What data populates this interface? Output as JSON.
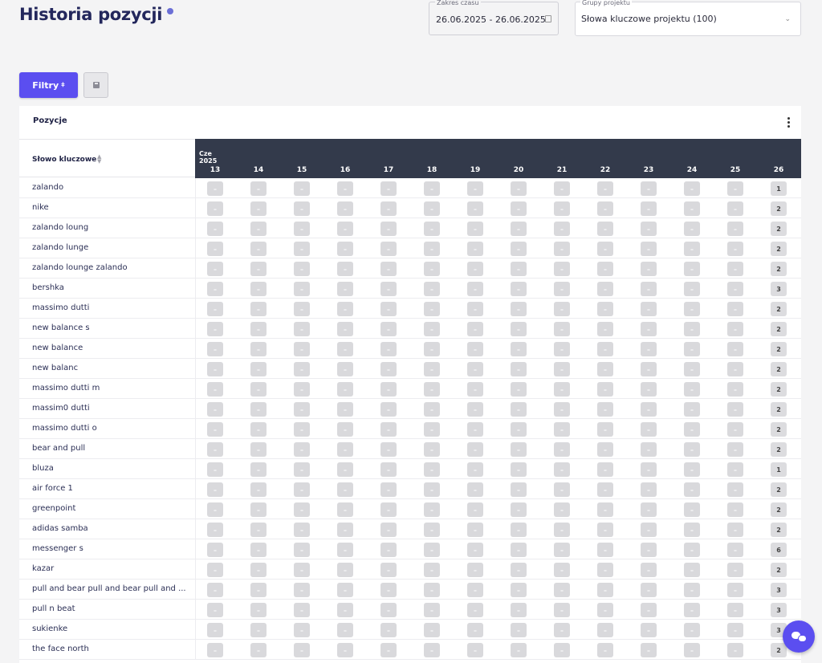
{
  "page": {
    "title": "Historia pozycji"
  },
  "date_range": {
    "label": "Zakres czasu",
    "value": "26.06.2025 - 26.06.2025"
  },
  "project_groups": {
    "label": "Grupy projektu",
    "value": "Słowa kluczowe projektu (100)"
  },
  "toolbar": {
    "filters_label": "Filtry",
    "filters_icon": "⧧"
  },
  "panel": {
    "title": "Pozycje"
  },
  "table": {
    "keyword_header": "Słowo kluczowe",
    "month_label": "Cze",
    "year_label": "2025",
    "days": [
      "13",
      "14",
      "15",
      "16",
      "17",
      "18",
      "19",
      "20",
      "21",
      "22",
      "23",
      "24",
      "25",
      "26"
    ],
    "empty_mark": "–",
    "rows": [
      {
        "keyword": "zalando",
        "positions": [
          "–",
          "–",
          "–",
          "–",
          "–",
          "–",
          "–",
          "–",
          "–",
          "–",
          "–",
          "–",
          "–",
          "1"
        ]
      },
      {
        "keyword": "nike",
        "positions": [
          "–",
          "–",
          "–",
          "–",
          "–",
          "–",
          "–",
          "–",
          "–",
          "–",
          "–",
          "–",
          "–",
          "2"
        ]
      },
      {
        "keyword": "zalando loung",
        "positions": [
          "–",
          "–",
          "–",
          "–",
          "–",
          "–",
          "–",
          "–",
          "–",
          "–",
          "–",
          "–",
          "–",
          "2"
        ]
      },
      {
        "keyword": "zalando lunge",
        "positions": [
          "–",
          "–",
          "–",
          "–",
          "–",
          "–",
          "–",
          "–",
          "–",
          "–",
          "–",
          "–",
          "–",
          "2"
        ]
      },
      {
        "keyword": "zalando lounge zalando",
        "positions": [
          "–",
          "–",
          "–",
          "–",
          "–",
          "–",
          "–",
          "–",
          "–",
          "–",
          "–",
          "–",
          "–",
          "2"
        ]
      },
      {
        "keyword": "bershka",
        "positions": [
          "–",
          "–",
          "–",
          "–",
          "–",
          "–",
          "–",
          "–",
          "–",
          "–",
          "–",
          "–",
          "–",
          "3"
        ]
      },
      {
        "keyword": "massimo dutti",
        "positions": [
          "–",
          "–",
          "–",
          "–",
          "–",
          "–",
          "–",
          "–",
          "–",
          "–",
          "–",
          "–",
          "–",
          "2"
        ]
      },
      {
        "keyword": "new balance s",
        "positions": [
          "–",
          "–",
          "–",
          "–",
          "–",
          "–",
          "–",
          "–",
          "–",
          "–",
          "–",
          "–",
          "–",
          "2"
        ]
      },
      {
        "keyword": "new balance",
        "positions": [
          "–",
          "–",
          "–",
          "–",
          "–",
          "–",
          "–",
          "–",
          "–",
          "–",
          "–",
          "–",
          "–",
          "2"
        ]
      },
      {
        "keyword": "new balanc",
        "positions": [
          "–",
          "–",
          "–",
          "–",
          "–",
          "–",
          "–",
          "–",
          "–",
          "–",
          "–",
          "–",
          "–",
          "2"
        ]
      },
      {
        "keyword": "massimo dutti m",
        "positions": [
          "–",
          "–",
          "–",
          "–",
          "–",
          "–",
          "–",
          "–",
          "–",
          "–",
          "–",
          "–",
          "–",
          "2"
        ]
      },
      {
        "keyword": "massim0 dutti",
        "positions": [
          "–",
          "–",
          "–",
          "–",
          "–",
          "–",
          "–",
          "–",
          "–",
          "–",
          "–",
          "–",
          "–",
          "2"
        ]
      },
      {
        "keyword": "massimo dutti o",
        "positions": [
          "–",
          "–",
          "–",
          "–",
          "–",
          "–",
          "–",
          "–",
          "–",
          "–",
          "–",
          "–",
          "–",
          "2"
        ]
      },
      {
        "keyword": "bear and pull",
        "positions": [
          "–",
          "–",
          "–",
          "–",
          "–",
          "–",
          "–",
          "–",
          "–",
          "–",
          "–",
          "–",
          "–",
          "2"
        ]
      },
      {
        "keyword": "bluza",
        "positions": [
          "–",
          "–",
          "–",
          "–",
          "–",
          "–",
          "–",
          "–",
          "–",
          "–",
          "–",
          "–",
          "–",
          "1"
        ]
      },
      {
        "keyword": "air force 1",
        "positions": [
          "–",
          "–",
          "–",
          "–",
          "–",
          "–",
          "–",
          "–",
          "–",
          "–",
          "–",
          "–",
          "–",
          "2"
        ]
      },
      {
        "keyword": "greenpoint",
        "positions": [
          "–",
          "–",
          "–",
          "–",
          "–",
          "–",
          "–",
          "–",
          "–",
          "–",
          "–",
          "–",
          "–",
          "2"
        ]
      },
      {
        "keyword": "adidas samba",
        "positions": [
          "–",
          "–",
          "–",
          "–",
          "–",
          "–",
          "–",
          "–",
          "–",
          "–",
          "–",
          "–",
          "–",
          "2"
        ]
      },
      {
        "keyword": "messenger s",
        "positions": [
          "–",
          "–",
          "–",
          "–",
          "–",
          "–",
          "–",
          "–",
          "–",
          "–",
          "–",
          "–",
          "–",
          "6"
        ]
      },
      {
        "keyword": "kazar",
        "positions": [
          "–",
          "–",
          "–",
          "–",
          "–",
          "–",
          "–",
          "–",
          "–",
          "–",
          "–",
          "–",
          "–",
          "2"
        ]
      },
      {
        "keyword": "pull and bear pull and bear pull and ...",
        "positions": [
          "–",
          "–",
          "–",
          "–",
          "–",
          "–",
          "–",
          "–",
          "–",
          "–",
          "–",
          "–",
          "–",
          "3"
        ]
      },
      {
        "keyword": "pull n beat",
        "positions": [
          "–",
          "–",
          "–",
          "–",
          "–",
          "–",
          "–",
          "–",
          "–",
          "–",
          "–",
          "–",
          "–",
          "3"
        ]
      },
      {
        "keyword": "sukienke",
        "positions": [
          "–",
          "–",
          "–",
          "–",
          "–",
          "–",
          "–",
          "–",
          "–",
          "–",
          "–",
          "–",
          "–",
          "3"
        ]
      },
      {
        "keyword": "the face north",
        "positions": [
          "–",
          "–",
          "–",
          "–",
          "–",
          "–",
          "–",
          "–",
          "–",
          "–",
          "–",
          "–",
          "–",
          "2"
        ]
      }
    ]
  },
  "colors": {
    "accent": "#5b4ef0",
    "header_bg": "#333a4b",
    "title": "#23275c"
  }
}
